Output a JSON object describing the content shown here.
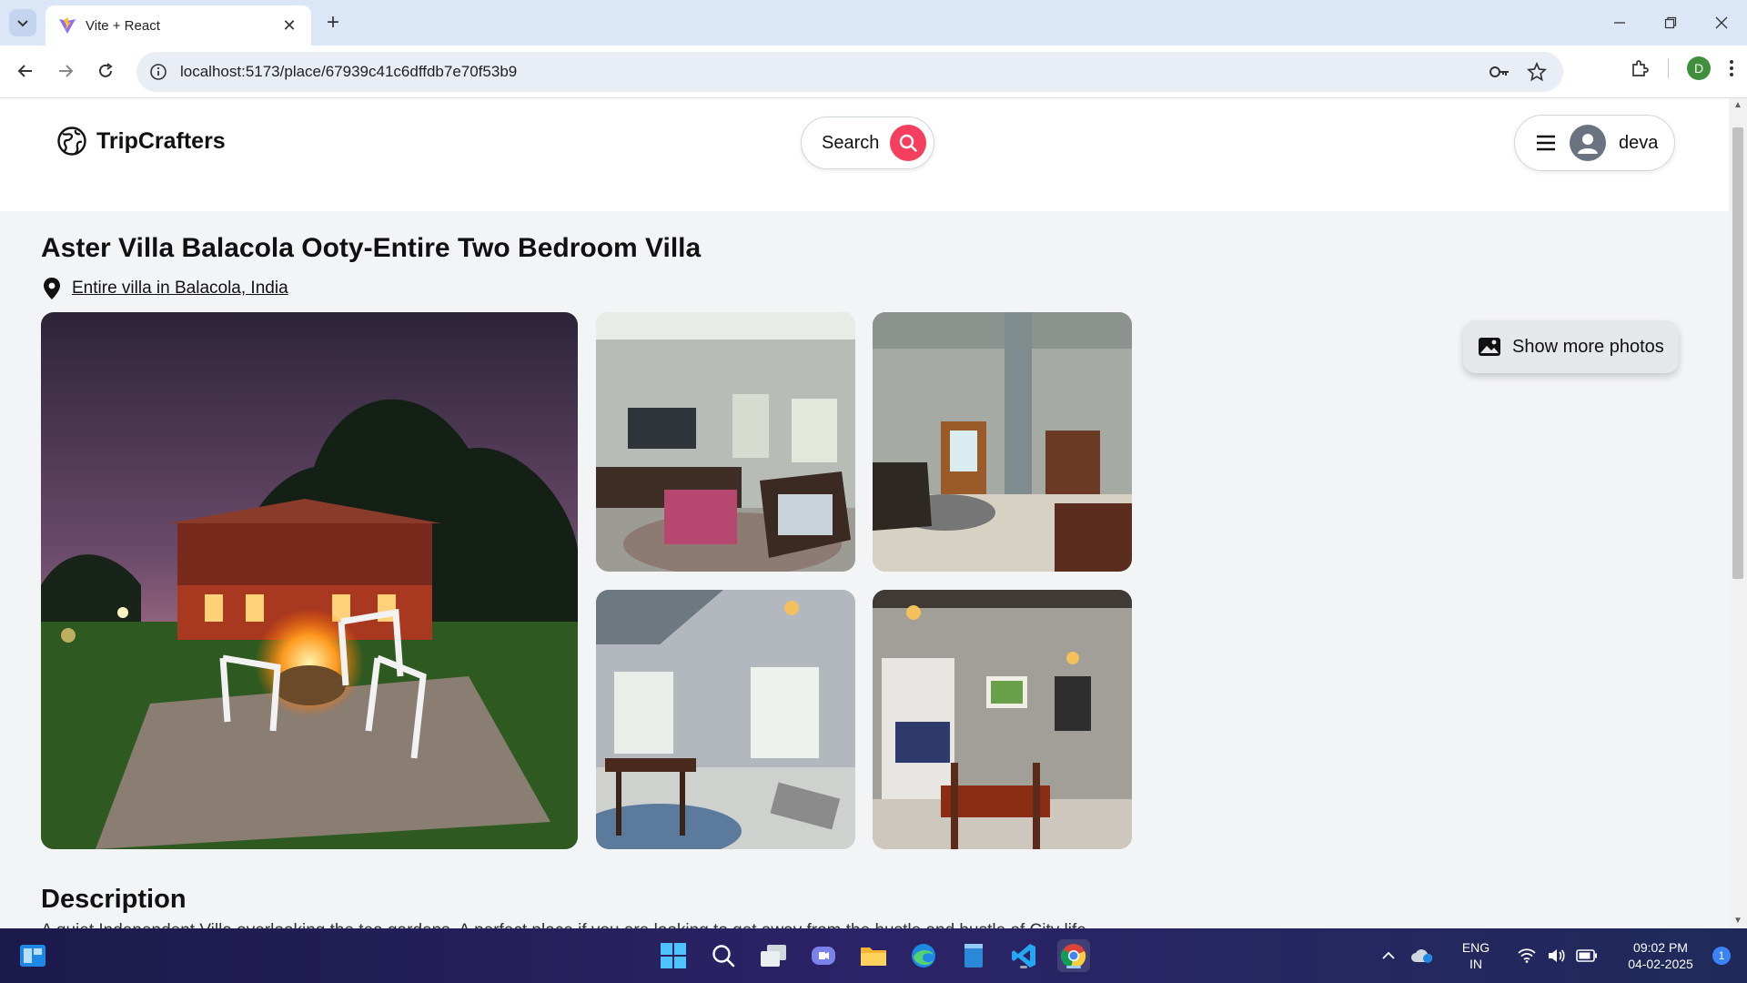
{
  "browser": {
    "tab_title": "Vite + React",
    "url": "localhost:5173/place/67939c41c6dffdb7e70f53b9",
    "profile_initial": "D"
  },
  "header": {
    "logo_text": "TripCrafters",
    "search_label": "Search",
    "user_name": "deva"
  },
  "place": {
    "title": "Aster Villa Balacola Ooty-Entire Two Bedroom Villa",
    "address": "Entire villa in Balacola, India",
    "show_more_label": "Show more photos",
    "description_heading": "Description",
    "description_text": "A quiet Independent Villa overlooking the tea gardens. A perfect place if you are looking to get away from the hustle and bustle of City life"
  },
  "photos": [
    {
      "name": "villa-exterior-firepit",
      "alt": "Villa exterior at night with fire pit"
    },
    {
      "name": "living-room-tv",
      "alt": "Living room with TV"
    },
    {
      "name": "hallway-view",
      "alt": "Hallway view"
    },
    {
      "name": "dining-room-windows",
      "alt": "Dining area with windows"
    },
    {
      "name": "dining-bedroom-view",
      "alt": "Dining table and bedroom doorway"
    }
  ],
  "taskbar": {
    "lang_line1": "ENG",
    "lang_line2": "IN",
    "time": "09:02 PM",
    "date": "04-02-2025",
    "notification_count": "1"
  },
  "colors": {
    "accent": "#f43f5e",
    "page_bg": "#f3f4f6",
    "header_bg": "#ffffff",
    "tabstrip_bg": "#dbe6f7"
  }
}
